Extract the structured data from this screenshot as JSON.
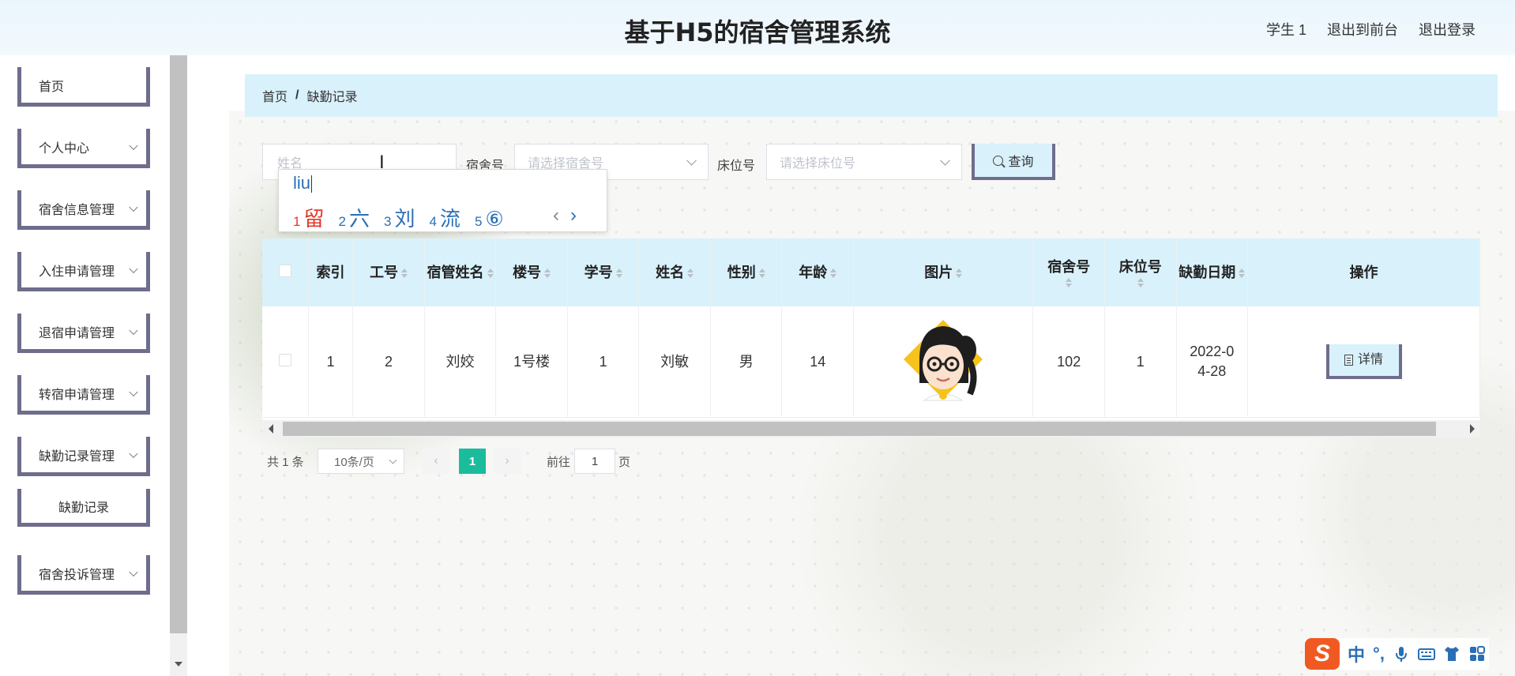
{
  "header": {
    "title": "基于H5的宿舍管理系统",
    "user": "学生 1",
    "back_to_front": "退出到前台",
    "logout": "退出登录"
  },
  "sidebar": {
    "items": [
      {
        "label": "首页",
        "expandable": false
      },
      {
        "label": "个人中心",
        "expandable": true
      },
      {
        "label": "宿舍信息管理",
        "expandable": true
      },
      {
        "label": "入住申请管理",
        "expandable": true
      },
      {
        "label": "退宿申请管理",
        "expandable": true
      },
      {
        "label": "转宿申请管理",
        "expandable": true
      },
      {
        "label": "缺勤记录管理",
        "expandable": true
      },
      {
        "label": "缺勤记录",
        "expandable": false
      },
      {
        "label": "宿舍投诉管理",
        "expandable": true
      }
    ]
  },
  "breadcrumb": {
    "home": "首页",
    "separator": "/",
    "current": "缺勤记录"
  },
  "search": {
    "name_placeholder": "姓名",
    "dorm_label": "宿舍号",
    "dorm_placeholder": "请选择宿舍号",
    "bed_label": "床位号",
    "bed_placeholder": "请选择床位号",
    "query_label": "查询"
  },
  "ime": {
    "input": "liu",
    "candidates": [
      {
        "n": "1",
        "text": "留"
      },
      {
        "n": "2",
        "text": "六"
      },
      {
        "n": "3",
        "text": "刘"
      },
      {
        "n": "4",
        "text": "流"
      },
      {
        "n": "5",
        "text": "⑥"
      }
    ],
    "prev": "‹",
    "next": "›"
  },
  "table": {
    "headers": {
      "index": "索引",
      "staff_no": "工号",
      "manager_name": "宿管姓名",
      "building": "楼号",
      "student_no": "学号",
      "name": "姓名",
      "gender": "性别",
      "age": "年龄",
      "photo": "图片",
      "dorm_no": "宿舍号",
      "bed_no": "床位号",
      "absence_date": "缺勤日期",
      "actions": "操作"
    },
    "rows": [
      {
        "index": "1",
        "staff_no": "2",
        "manager_name": "刘姣",
        "building": "1号楼",
        "student_no": "1",
        "name": "刘敏",
        "gender": "男",
        "age": "14",
        "dorm_no": "102",
        "bed_no": "1",
        "absence_date": "2022-04-28",
        "detail_label": "详情"
      }
    ]
  },
  "pagination": {
    "total": "共 1 条",
    "page_size": "10条/页",
    "current_page": "1",
    "goto_prefix": "前往",
    "goto_value": "1",
    "goto_suffix": "页"
  },
  "ime_toolbar": {
    "mode": "中",
    "punct": "°,"
  },
  "colors": {
    "accent_light_blue": "#d9f1fb",
    "button_border": "#6f6d8c",
    "active_page": "#1abc9c",
    "ime_logo": "#f05a22"
  }
}
